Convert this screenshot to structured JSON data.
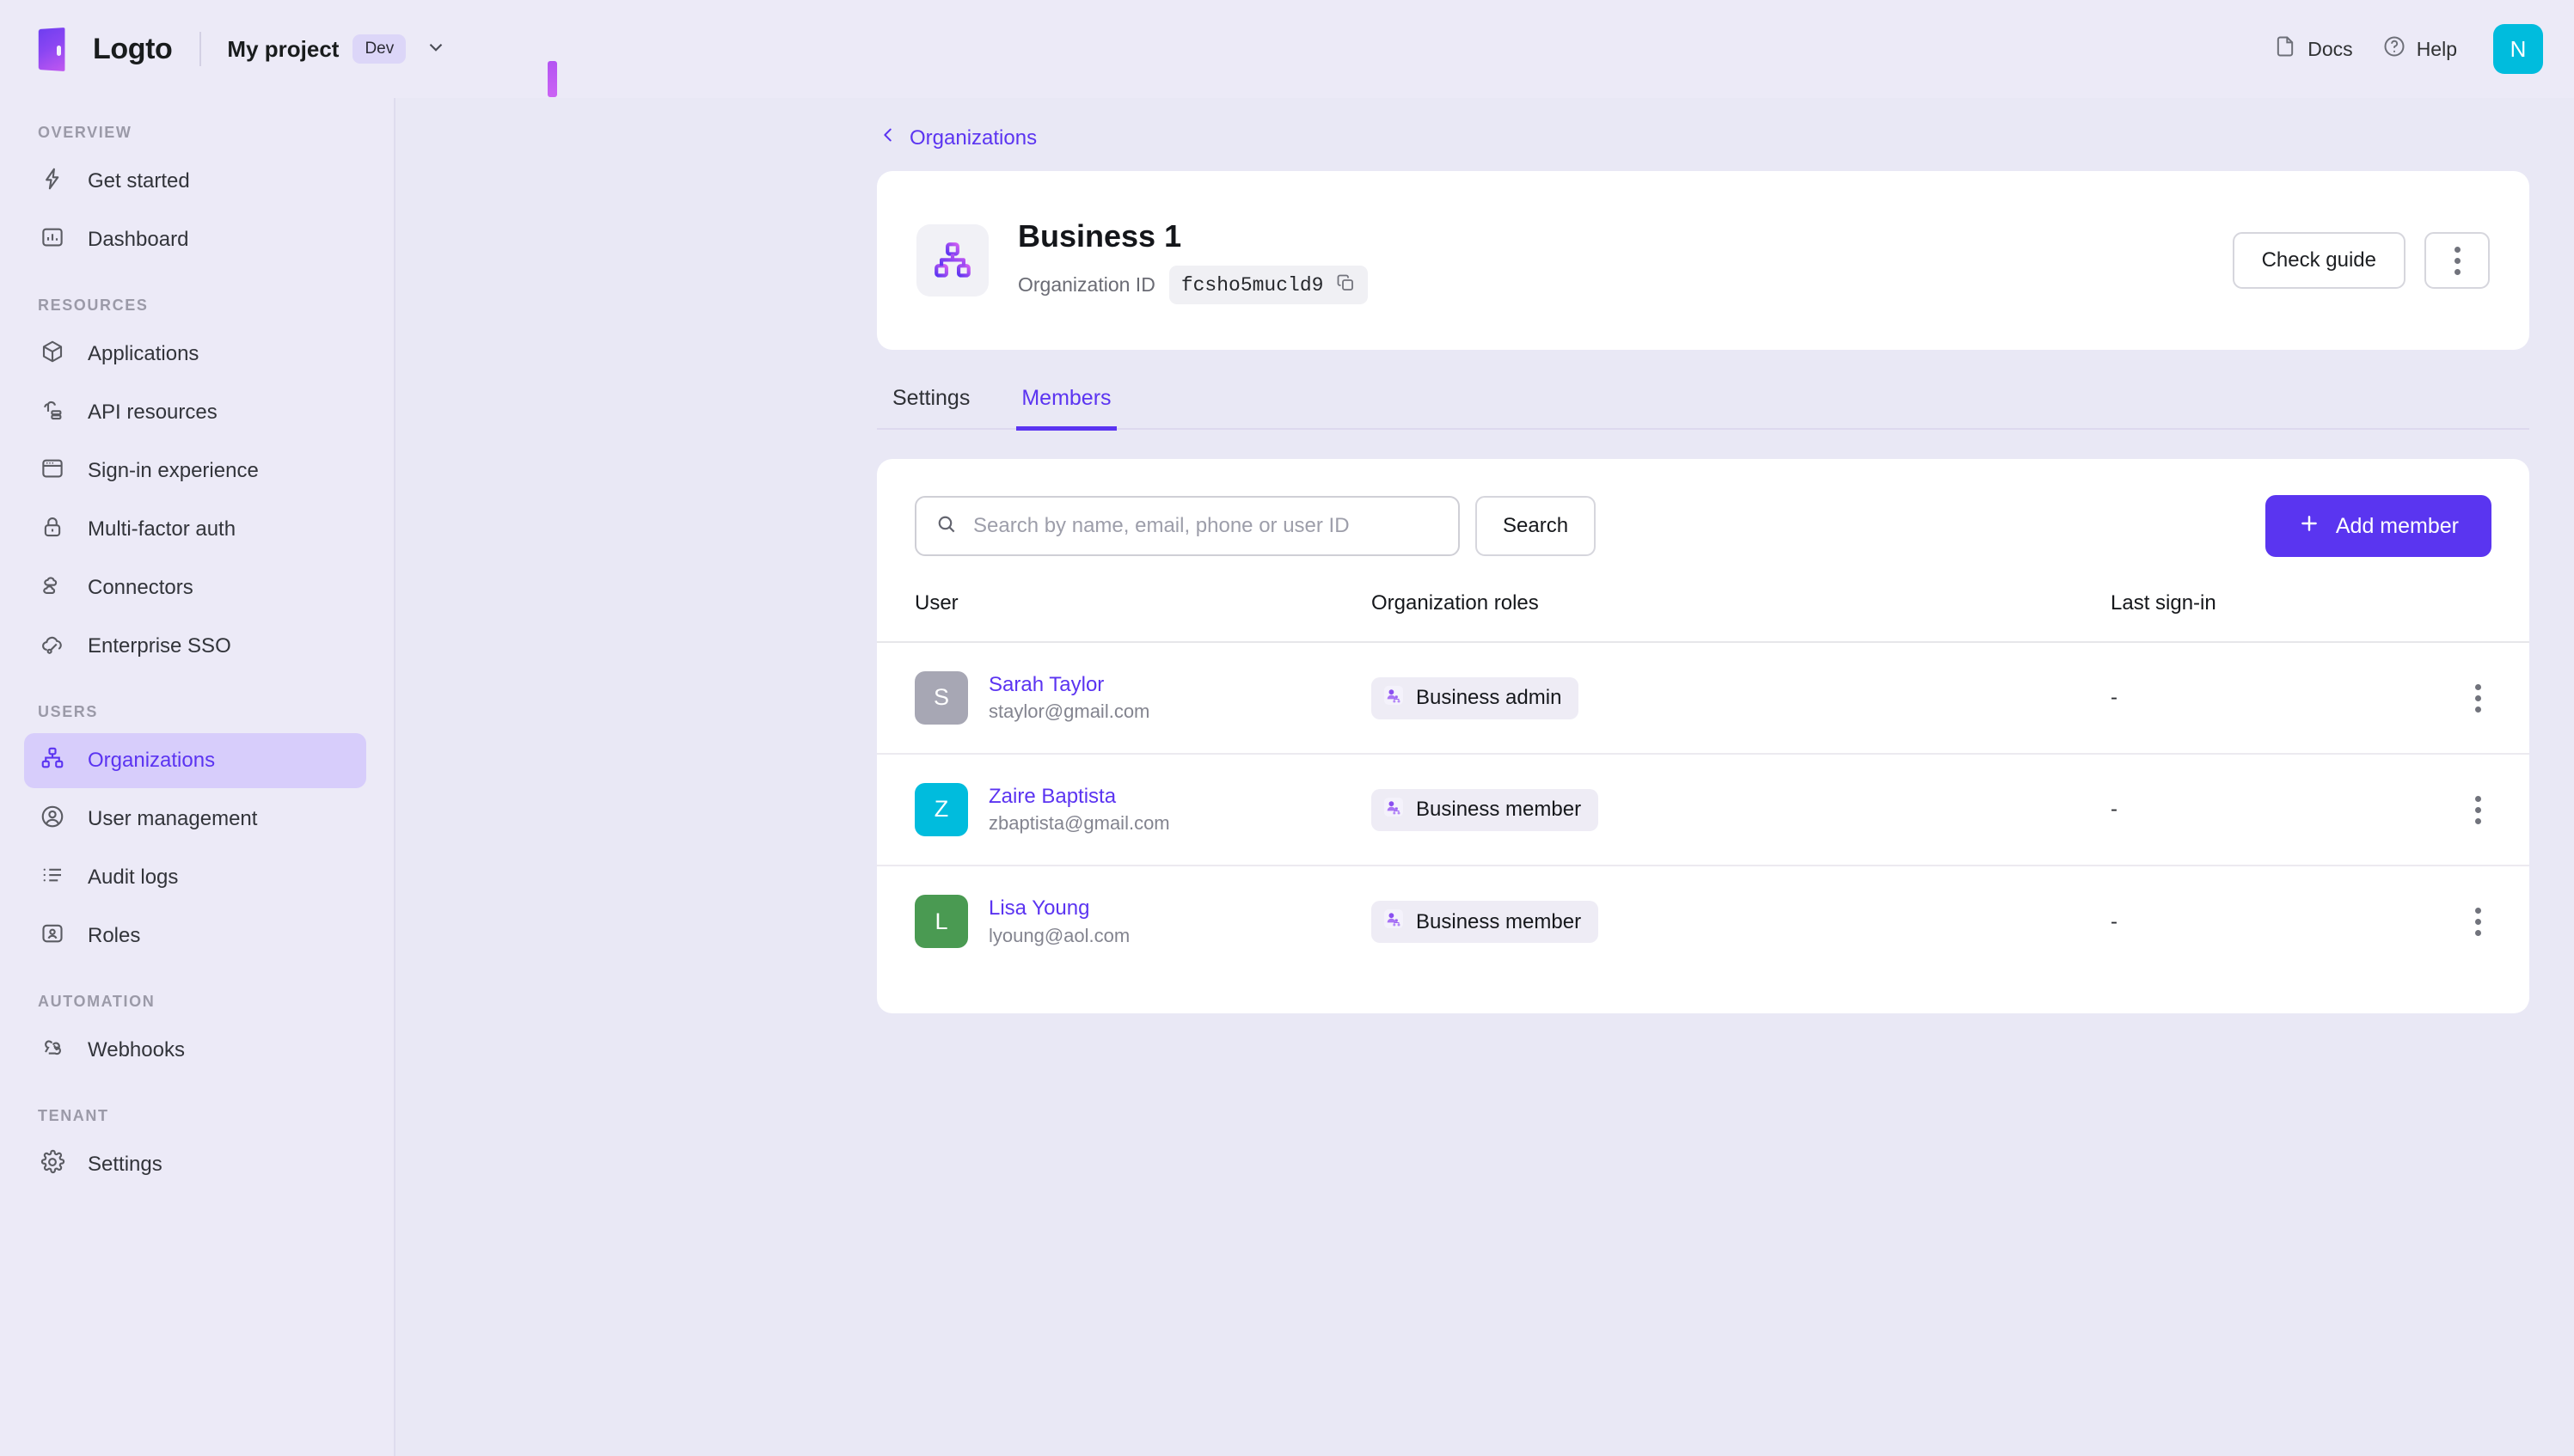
{
  "topbar": {
    "logo_text": "Logto",
    "project_name": "My project",
    "env_tag": "Dev",
    "docs_label": "Docs",
    "help_label": "Help",
    "avatar_initial": "N"
  },
  "sidebar": {
    "sections": [
      {
        "label": "OVERVIEW",
        "items": [
          {
            "label": "Get started",
            "icon": "lightning-icon",
            "active": false
          },
          {
            "label": "Dashboard",
            "icon": "chart-box-icon",
            "active": false
          }
        ]
      },
      {
        "label": "RESOURCES",
        "items": [
          {
            "label": "Applications",
            "icon": "cube-icon",
            "active": false
          },
          {
            "label": "API resources",
            "icon": "api-icon",
            "active": false
          },
          {
            "label": "Sign-in experience",
            "icon": "browser-window-icon",
            "active": false
          },
          {
            "label": "Multi-factor auth",
            "icon": "lock-icon",
            "active": false
          },
          {
            "label": "Connectors",
            "icon": "connectors-icon",
            "active": false
          },
          {
            "label": "Enterprise SSO",
            "icon": "cloud-key-icon",
            "active": false
          }
        ]
      },
      {
        "label": "USERS",
        "items": [
          {
            "label": "Organizations",
            "icon": "org-chart-icon",
            "active": true
          },
          {
            "label": "User management",
            "icon": "user-circle-icon",
            "active": false
          },
          {
            "label": "Audit logs",
            "icon": "list-icon",
            "active": false
          },
          {
            "label": "Roles",
            "icon": "id-card-icon",
            "active": false
          }
        ]
      },
      {
        "label": "AUTOMATION",
        "items": [
          {
            "label": "Webhooks",
            "icon": "webhook-icon",
            "active": false
          }
        ]
      },
      {
        "label": "TENANT",
        "items": [
          {
            "label": "Settings",
            "icon": "gear-icon",
            "active": false
          }
        ]
      }
    ]
  },
  "breadcrumb": {
    "back_label": "Organizations"
  },
  "org_header": {
    "title": "Business 1",
    "id_label": "Organization ID",
    "id_value": "fcsho5mucld9",
    "check_guide_label": "Check guide"
  },
  "tabs": [
    {
      "label": "Settings",
      "active": false
    },
    {
      "label": "Members",
      "active": true
    }
  ],
  "members_panel": {
    "search_placeholder": "Search by name, email, phone or user ID",
    "search_value": "",
    "search_button_label": "Search",
    "add_member_label": "Add member",
    "columns": [
      "User",
      "Organization roles",
      "Last sign-in"
    ],
    "rows": [
      {
        "initial": "S",
        "avatar_color": "#a7a7b4",
        "name": "Sarah Taylor",
        "email": "staylor@gmail.com",
        "role": "Business admin",
        "last_sign_in": "-"
      },
      {
        "initial": "Z",
        "avatar_color": "#00bcdd",
        "name": "Zaire Baptista",
        "email": "zbaptista@gmail.com",
        "role": "Business member",
        "last_sign_in": "-"
      },
      {
        "initial": "L",
        "avatar_color": "#4a9a52",
        "name": "Lisa Young",
        "email": "lyoung@aol.com",
        "role": "Business member",
        "last_sign_in": "-"
      }
    ]
  },
  "colors": {
    "accent": "#5a35f0",
    "page_bg": "#e9e8f5",
    "chrome_bg": "#eceaf7"
  }
}
